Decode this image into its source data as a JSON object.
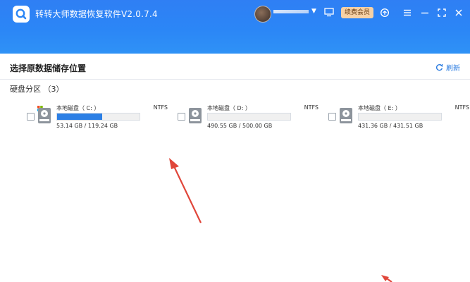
{
  "app": {
    "title": "转转大师数据恢复软件V2.0.7.4",
    "vip_label": "续费会员"
  },
  "header": {
    "title": "选择原数据储存位置",
    "refresh_label": "刷新",
    "section_label": "硬盘分区 （3）"
  },
  "drives": [
    {
      "name": "本地磁盘（ C: ）",
      "fs": "NTFS",
      "usage": "53.14 GB / 119.24 GB",
      "used_fraction": 0.55,
      "system": true
    },
    {
      "name": "本地磁盘（ D: ）",
      "fs": "NTFS",
      "usage": "490.55 GB / 500.00 GB",
      "used_fraction": 0.0,
      "system": false
    },
    {
      "name": "本地磁盘（ E: ）",
      "fs": "NTFS",
      "usage": "431.36 GB / 431.51 GB",
      "used_fraction": 0.0,
      "system": false
    }
  ],
  "colors": {
    "titlebar": "#2b86f6",
    "accent": "#2c7fe5",
    "vip_bg": "#f6d1a6",
    "annotation_arrow": "#e0463a"
  }
}
